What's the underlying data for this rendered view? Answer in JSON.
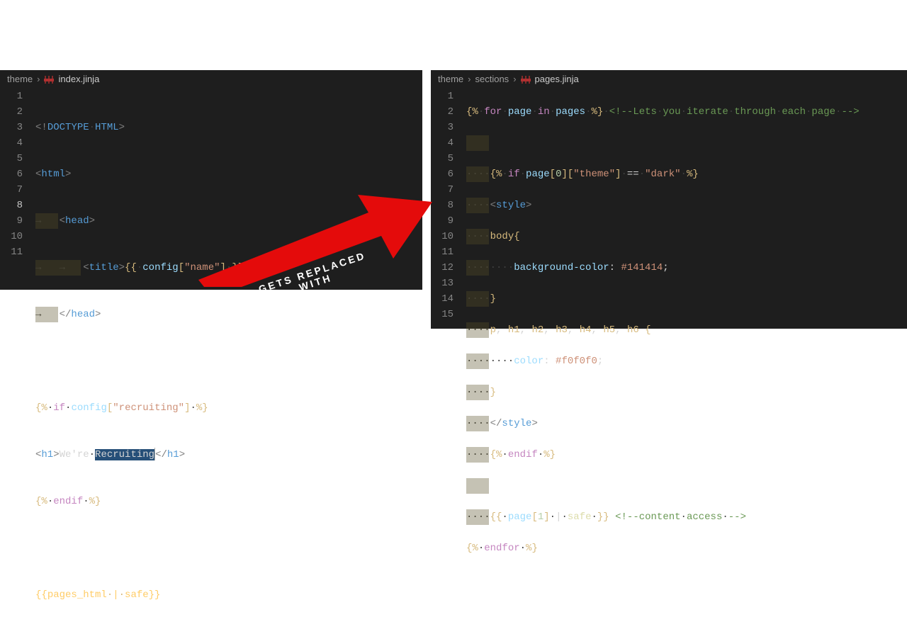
{
  "arrow_label_line1": "GETS REPLACED",
  "arrow_label_line2": "WITH",
  "left": {
    "breadcrumb": [
      "theme",
      "index.jinja"
    ],
    "active_line": 8,
    "line_nums": [
      "1",
      "2",
      "3",
      "4",
      "5",
      "6",
      "7",
      "8",
      "9",
      "10",
      "11"
    ],
    "lines": {
      "l1": {
        "lt": "<!",
        "doctype": "DOCTYPE",
        "sp": " ",
        "html": "HTML",
        "gt": ">"
      },
      "l2": {
        "lt": "<",
        "tag": "html",
        "gt": ">"
      },
      "l3": {
        "lt": "<",
        "tag": "head",
        "gt": ">"
      },
      "l4": {
        "lt1": "<",
        "t1": "title",
        "gt1": ">",
        "od": "{{",
        "sp": " ",
        "cfg": "config",
        "br1": "[",
        "key": "\"name\"",
        "br2": "]",
        "sp2": " ",
        "cd": "}}",
        "lt2": "</",
        "t2": "title",
        "gt2": ">"
      },
      "l5": {
        "lt": "</",
        "tag": "head",
        "gt": ">"
      },
      "l7": {
        "od": "{%",
        "sp": " ",
        "if": "if",
        "sp2": " ",
        "cfg": "config",
        "br1": "[",
        "key": "\"recruiting\"",
        "br2": "]",
        "sp3": " ",
        "cd": "%}"
      },
      "l8": {
        "lt1": "<",
        "t1": "h1",
        "gt1": ">",
        "txt1": "We're",
        "sp": " ",
        "txt2": "Recruiting",
        "lt2": "</",
        "t2": "h1",
        "gt2": ">"
      },
      "l9": {
        "od": "{%",
        "sp": " ",
        "endif": "endif",
        "sp2": " ",
        "cd": "%}"
      },
      "l11": {
        "od": "{{",
        "var": "pages_html",
        "sp": " ",
        "pipe": "|",
        "sp2": " ",
        "safe": "safe",
        "cd": "}}"
      }
    }
  },
  "right": {
    "breadcrumb": [
      "theme",
      "sections",
      "pages.jinja"
    ],
    "line_nums": [
      "1",
      "2",
      "3",
      "4",
      "5",
      "6",
      "7",
      "8",
      "9",
      "10",
      "11",
      "12",
      "13",
      "14",
      "15"
    ],
    "lines": {
      "l1": {
        "od": "{%",
        "sp": " ",
        "for": "for",
        "sp2": " ",
        "page": "page",
        "sp3": " ",
        "in": "in",
        "sp4": " ",
        "pages": "pages",
        "sp5": " ",
        "cd": "%}",
        "sp6": " ",
        "c1": "<!--",
        "c2": "Lets",
        "c3": "you",
        "c4": "iterate",
        "c5": "through",
        "c6": "each",
        "c7": "page",
        "c8": "-->"
      },
      "l3": {
        "od": "{%",
        "sp": " ",
        "if": "if",
        "sp2": " ",
        "page": "page",
        "br1": "[",
        "idx": "0",
        "br2": "][",
        "key": "\"theme\"",
        "br3": "]",
        "sp3": " ",
        "eq": "==",
        "sp4": " ",
        "val": "\"dark\"",
        "sp5": " ",
        "cd": "%}"
      },
      "l4": {
        "lt": "<",
        "tag": "style",
        "gt": ">"
      },
      "l5": {
        "sel": "body",
        "ob": "{"
      },
      "l6": {
        "prop": "background-color",
        "col": ":",
        "sp": " ",
        "val": "#141414",
        "semi": ";"
      },
      "l7": {
        "cb": "}"
      },
      "l8": {
        "sel": "p",
        "c1": ",",
        "s1": " ",
        "h1": "h1",
        "c2": ",",
        "s2": " ",
        "h2": "h2",
        "c3": ",",
        "s3": " ",
        "h3": "h3",
        "c4": ",",
        "s4": " ",
        "h4": "h4",
        "c5": ",",
        "s5": " ",
        "h5": "h5",
        "c6": ",",
        "s6": " ",
        "h6": "h6",
        "s7": " ",
        "ob": "{"
      },
      "l9": {
        "prop": "color",
        "col": ":",
        "sp": " ",
        "val": "#f0f0f0",
        "semi": ";"
      },
      "l10": {
        "cb": "}"
      },
      "l11": {
        "lt": "</",
        "tag": "style",
        "gt": ">"
      },
      "l12": {
        "od": "{%",
        "sp": " ",
        "endif": "endif",
        "sp2": " ",
        "cd": "%}"
      },
      "l14": {
        "od": "{{",
        "sp": " ",
        "page": "page",
        "br1": "[",
        "idx": "1",
        "br2": "]",
        "sp2": " ",
        "pipe": "|",
        "sp3": " ",
        "safe": "safe",
        "sp4": " ",
        "cd": "}}",
        "sp5": " ",
        "c1": "<!--",
        "c2": "content",
        "c3": "access",
        "c4": "-->"
      },
      "l15": {
        "od": "{%",
        "sp": " ",
        "endfor": "endfor",
        "sp2": " ",
        "cd": "%}"
      }
    }
  }
}
